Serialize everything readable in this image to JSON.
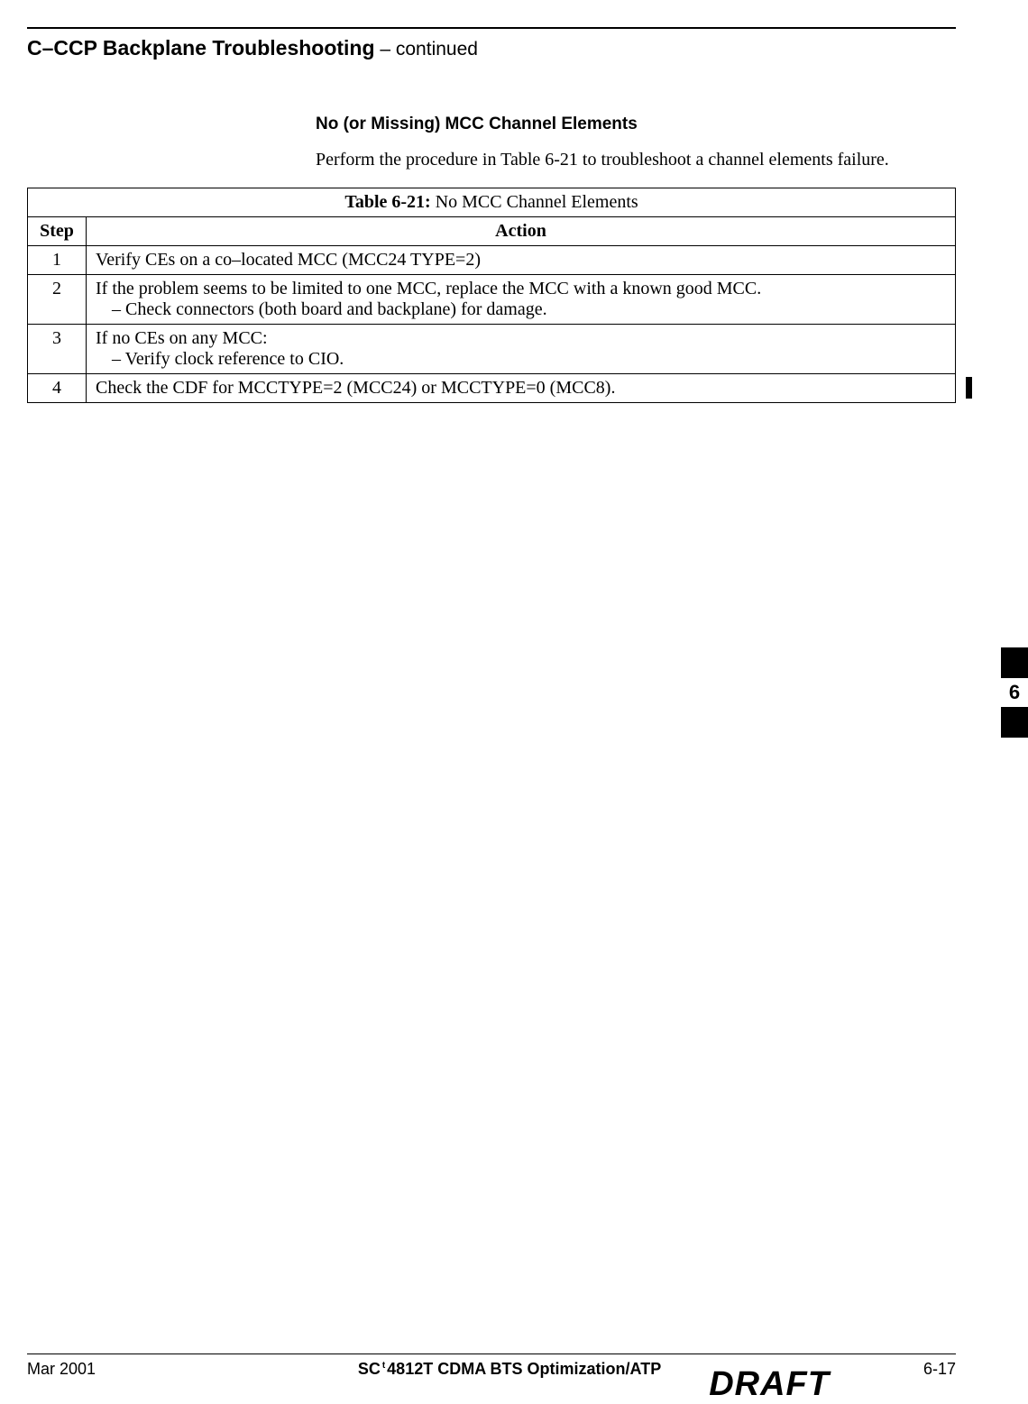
{
  "header": {
    "title": "C–CCP Backplane Troubleshooting",
    "suffix": " – continued"
  },
  "section": {
    "heading": "No (or Missing) MCC Channel Elements",
    "paragraph": "Perform the procedure in Table 6-21 to troubleshoot a channel elements failure."
  },
  "table": {
    "caption_label": "Table 6-21:",
    "caption_text": " No MCC Channel Elements",
    "col_step": "Step",
    "col_action": "Action",
    "rows": [
      {
        "step": "1",
        "action": "Verify CEs on a co–located MCC (MCC24 TYPE=2)",
        "bullets": []
      },
      {
        "step": "2",
        "action": "If the problem seems to be limited to one MCC, replace the MCC with a known good MCC.",
        "bullets": [
          "–  Check connectors (both board and backplane) for damage."
        ]
      },
      {
        "step": "3",
        "action": "If no CEs on any MCC:",
        "bullets": [
          "–  Verify clock reference to CIO."
        ]
      },
      {
        "step": "4",
        "action": "Check the CDF for MCCTYPE=2 (MCC24) or MCCTYPE=0 (MCC8).",
        "bullets": []
      }
    ]
  },
  "tab": {
    "label": "6"
  },
  "footer": {
    "left": "Mar 2001",
    "center_prefix": "SC",
    "center_tm": "t",
    "center_suffix": "4812T CDMA BTS Optimization/ATP",
    "right": "6-17",
    "draft": "DRAFT"
  }
}
